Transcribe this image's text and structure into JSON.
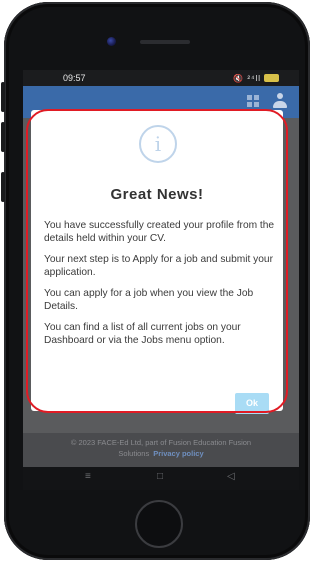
{
  "status_bar": {
    "time": "09:57",
    "icons_text": "🔇 ²⁴ll",
    "battery_color": "#d8c14a"
  },
  "header": {
    "color": "#3a6aa9",
    "icons": [
      "grid-icon",
      "user-icon"
    ]
  },
  "dialog": {
    "icon": "info-icon",
    "icon_glyph": "i",
    "title": "Great News!",
    "paragraphs": [
      "You have successfully created your profile from the details held within your CV.",
      "Your next step is to Apply for a job and submit your application.",
      "You can apply for a job when you view the Job Details.",
      "You can find a list of all current jobs on your Dashboard or via the Jobs menu option."
    ],
    "ok_label": "Ok"
  },
  "footer": {
    "copyright": "© 2023 FACE-Ed Ltd, part of Fusion Education Fusion",
    "solutions": "Solutions",
    "privacy_label": "Privacy policy"
  },
  "nav_bar": {
    "menu_icon": "≡",
    "home_icon": "□",
    "back_icon": "◁"
  }
}
